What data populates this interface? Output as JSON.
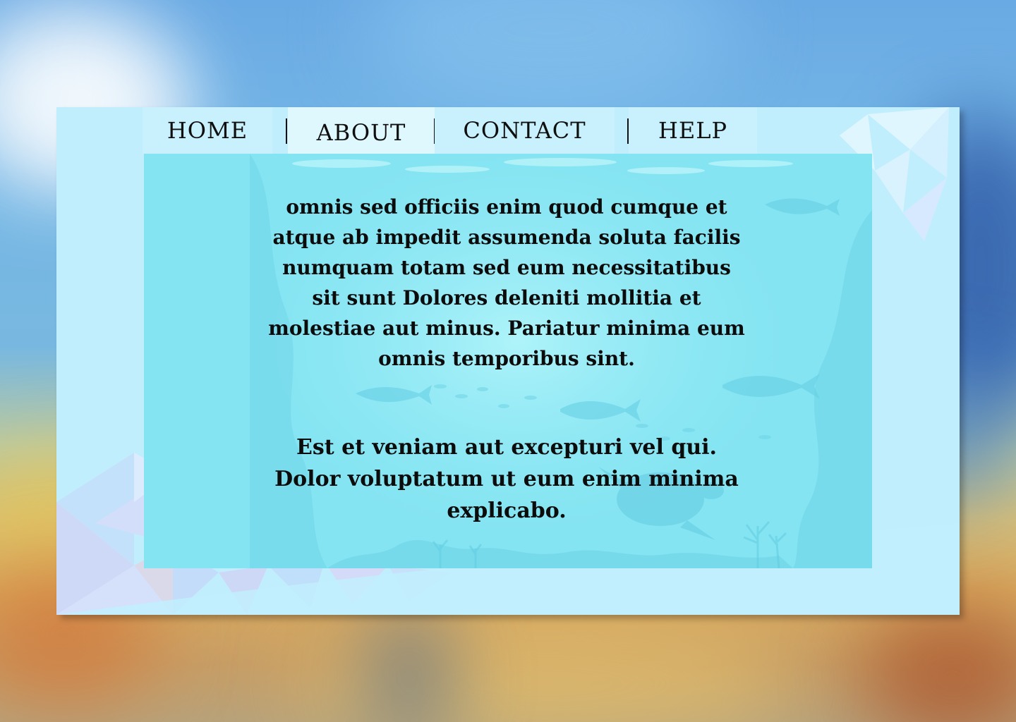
{
  "nav": {
    "items": [
      {
        "label": "HOME"
      },
      {
        "label": "ABOUT",
        "active": true
      },
      {
        "label": "CONTACT"
      },
      {
        "label": "HELP"
      }
    ]
  },
  "content": {
    "paragraph1": "omnis sed officiis enim quod cumque et atque ab impedit assumenda soluta facilis numquam totam sed eum necessitatibus sit sunt Dolores deleniti mollitia et molestiae aut minus. Pariatur minima eum omnis temporibus sint.",
    "paragraph2": "Est et veniam aut excepturi vel qui. Dolor voluptatum ut eum enim minima explicabo."
  },
  "colors": {
    "card_background": "#c1eefd",
    "panel_background": "#84e4f2",
    "active_tab": "#dff8fe",
    "text": "#0c0c0c"
  }
}
